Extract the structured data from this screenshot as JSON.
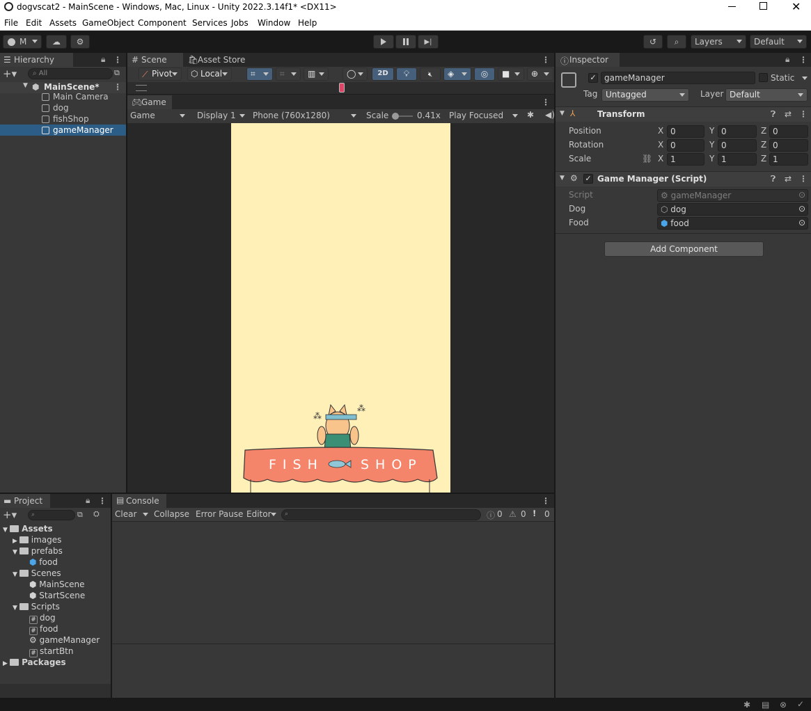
{
  "window": {
    "title": "dogvscat2 - MainScene - Windows, Mac, Linux - Unity 2022.3.14f1* <DX11>"
  },
  "menu": [
    "File",
    "Edit",
    "Assets",
    "GameObject",
    "Component",
    "Services",
    "Jobs",
    "Window",
    "Help"
  ],
  "toolbar": {
    "account": "M",
    "layers": "Layers",
    "layout": "Default"
  },
  "hierarchy": {
    "tab": "Hierarchy",
    "search_placeholder": "All",
    "scene": "MainScene*",
    "items": [
      "Main Camera",
      "dog",
      "fishShop",
      "gameManager"
    ],
    "selected": "gameManager"
  },
  "scene_tabs": {
    "scene": "Scene",
    "asset_store": "Asset Store"
  },
  "scene_toolbar": {
    "pivot": "Pivot",
    "local": "Local",
    "mode_2d": "2D"
  },
  "game": {
    "tab": "Game",
    "mode": "Game",
    "display": "Display 1",
    "resolution": "Phone (760x1280)",
    "scale_label": "Scale",
    "scale_value": "0.41x",
    "play_mode": "Play Focused",
    "shop_sign_left": "FISH",
    "shop_sign_right": "SHOP"
  },
  "inspector": {
    "tab": "Inspector",
    "object_name": "gameManager",
    "static_label": "Static",
    "tag_label": "Tag",
    "tag_value": "Untagged",
    "layer_label": "Layer",
    "layer_value": "Default",
    "transform": {
      "title": "Transform",
      "position": {
        "label": "Position",
        "x": "0",
        "y": "0",
        "z": "0"
      },
      "rotation": {
        "label": "Rotation",
        "x": "0",
        "y": "0",
        "z": "0"
      },
      "scale": {
        "label": "Scale",
        "x": "1",
        "y": "1",
        "z": "1"
      },
      "axis": {
        "x": "X",
        "y": "Y",
        "z": "Z"
      }
    },
    "script_component": {
      "title": "Game Manager (Script)",
      "script_label": "Script",
      "script_value": "gameManager",
      "dog_label": "Dog",
      "dog_value": "dog",
      "food_label": "Food",
      "food_value": "food"
    },
    "add_component": "Add Component"
  },
  "project": {
    "tab": "Project",
    "tree": [
      {
        "label": "Assets",
        "bold": true
      },
      {
        "label": "images"
      },
      {
        "label": "prefabs"
      },
      {
        "label": "food"
      },
      {
        "label": "Scenes"
      },
      {
        "label": "MainScene"
      },
      {
        "label": "StartScene"
      },
      {
        "label": "Scripts"
      },
      {
        "label": "dog"
      },
      {
        "label": "food"
      },
      {
        "label": "gameManager"
      },
      {
        "label": "startBtn"
      },
      {
        "label": "Packages",
        "bold": true
      }
    ]
  },
  "console": {
    "tab": "Console",
    "clear": "Clear",
    "collapse": "Collapse",
    "error_pause": "Error Pause",
    "editor": "Editor",
    "log_count": "0",
    "warn_count": "0",
    "error_count": "0"
  },
  "colors": {
    "accent_selected": "#2c5d87",
    "game_bg": "#fff0b8",
    "awning": "#f4856a",
    "panel": "#383838"
  }
}
